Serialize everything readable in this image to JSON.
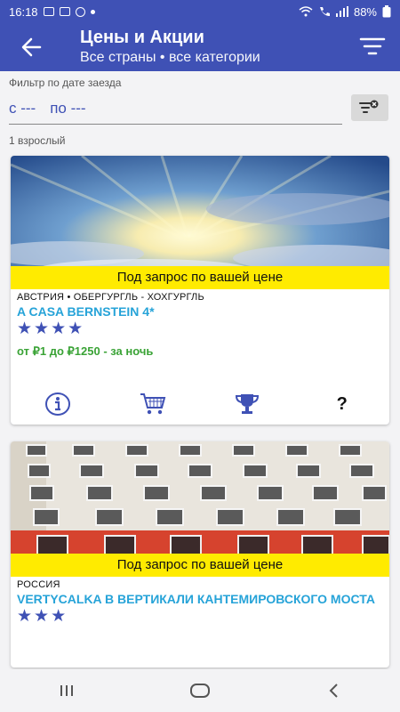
{
  "status_bar": {
    "time": "16:18",
    "battery": "88%"
  },
  "app_bar": {
    "title": "Цены и Акции",
    "subtitle": "Все страны • все категории"
  },
  "filter": {
    "label": "Фильтр по дате заезда",
    "from": "с ---",
    "to": "по ---",
    "guests": "1 взрослый"
  },
  "hotels": [
    {
      "banner": "Под запрос по вашей цене",
      "location": "АВСТРИЯ • ОБЕРГУРГЛЬ - ХОХГУРГЛЬ",
      "name": "A CASA BERNSTEIN 4*",
      "stars": "★★★★",
      "price": "от ₽1 до  ₽1250 -  за ночь"
    },
    {
      "banner": "Под запрос по вашей цене",
      "location": "РОССИЯ",
      "name": "VERTYCALKA В ВЕРТИКАЛИ КАНТЕМИРОВСКОГО МОСТА",
      "stars": "★★★"
    }
  ],
  "actions": {
    "help": "?"
  },
  "colors": {
    "primary": "#3f51b5",
    "banner": "#ffeb00",
    "hotel_name": "#26a3d8",
    "price": "#3aa336"
  }
}
